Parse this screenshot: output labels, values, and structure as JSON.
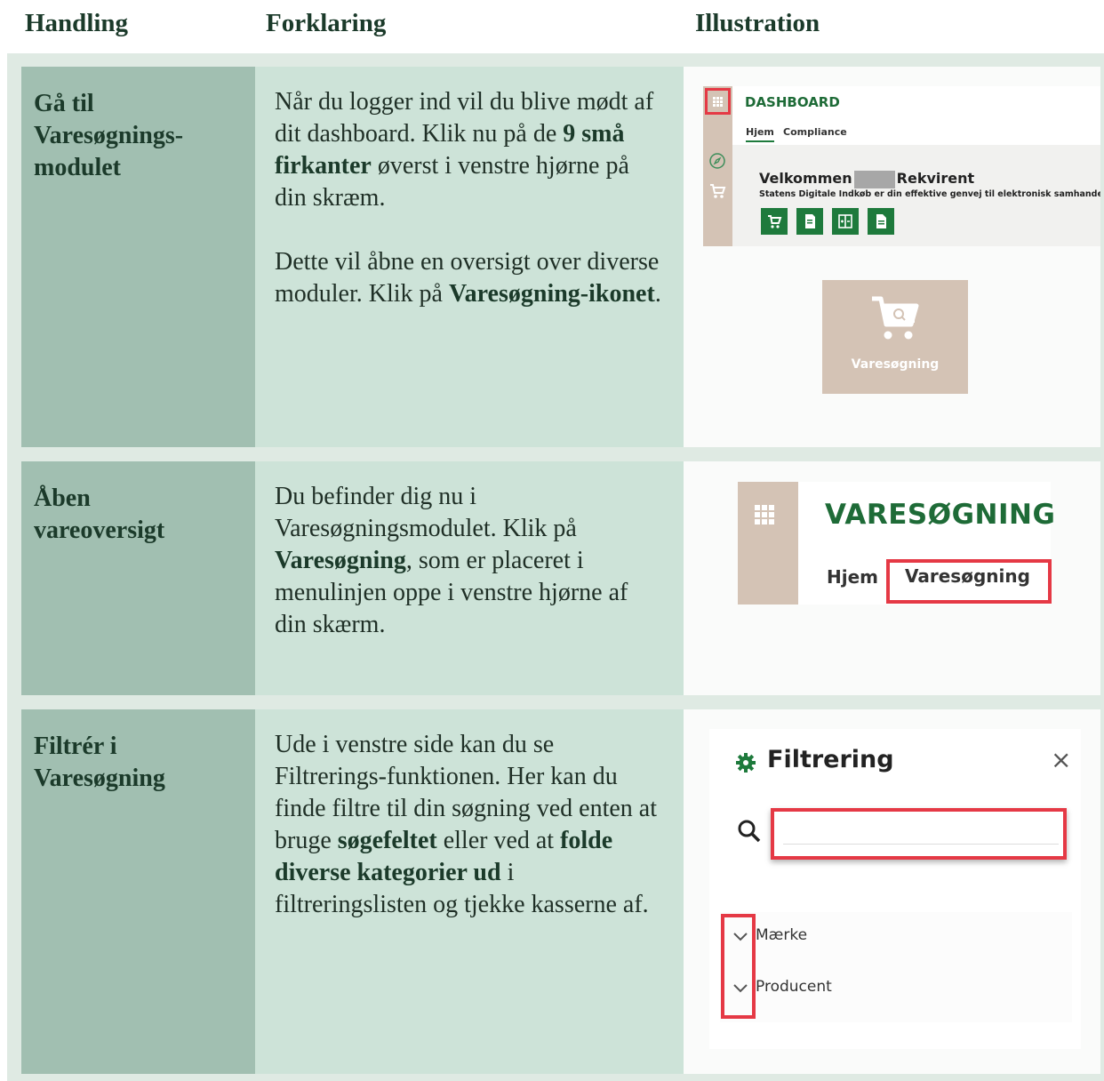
{
  "headers": {
    "action": "Handling",
    "explanation": "Forklaring",
    "illustration": "Illustration"
  },
  "rows": [
    {
      "action": "Gå til Varesøgnings-modulet",
      "exp1": {
        "before": "Når du logger ind vil du blive mødt af dit dashboard. Klik nu på de ",
        "bold": "9 små firkanter",
        "after": " øverst i venstre hjørne på din skræm."
      },
      "exp2": {
        "before": "Dette vil åbne en oversigt over diverse moduler. Klik på ",
        "bold": "Varesøgning-ikonet",
        "after": "."
      }
    },
    {
      "action": "Åben vareoversigt",
      "exp": {
        "before": "Du befinder dig nu i Varesøgningsmodulet. Klik på ",
        "bold": "Varesøgning",
        "after": ", som er placeret i menulinjen oppe i venstre hjørne af din skærm."
      }
    },
    {
      "action": "Filtrér i Varesøgning",
      "exp": {
        "before": "Ude i venstre side kan du se Filtrerings-funktionen. Her kan du finde filtre til din søgning ved enten at bruge ",
        "bold1": "søgefeltet",
        "mid": " eller ved at ",
        "bold2": "folde diverse kategorier ud",
        "after": " i filtreringslisten og tjekke kasserne af."
      }
    }
  ],
  "illus1": {
    "title": "DASHBOARD",
    "tab_home": "Hjem",
    "tab_compliance": "Compliance",
    "welcome_a": "Velkommen",
    "welcome_b": "Rekvirent",
    "subtitle": "Statens Digitale Indkøb er din effektive genvej til elektronisk samhandel",
    "tile_label": "Varesøgning"
  },
  "illus2": {
    "title": "VARESØGNING",
    "tab_home": "Hjem",
    "tab_active": "Varesøgning"
  },
  "illus3": {
    "title": "Filtrering",
    "close": "×",
    "items": [
      "Mærke",
      "Producent"
    ]
  },
  "colors": {
    "dark_green": "#1b3a2a",
    "action_col": "#a1bfb1",
    "explanation_col": "#cde3d8",
    "highlight_red": "#e53945",
    "brand_green": "#1e7a3c",
    "tile_beige": "#d4c3b5"
  }
}
